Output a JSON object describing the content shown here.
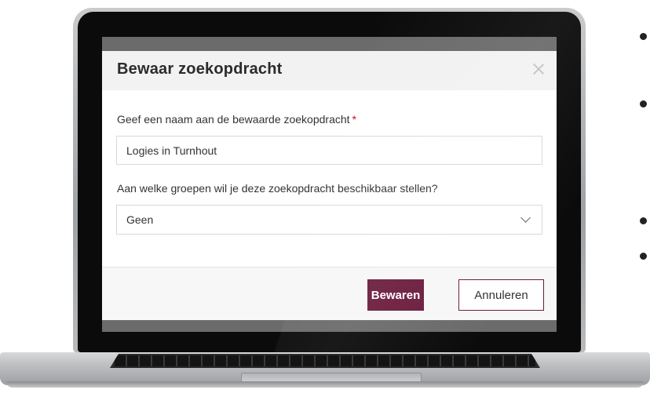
{
  "dialog": {
    "title": "Bewaar zoekopdracht",
    "name_label": "Geef een naam aan de bewaarde zoekopdracht",
    "required_mark": "*",
    "name_value": "Logies in Turnhout",
    "groups_label": "Aan welke groepen wil je deze zoekopdracht beschikbaar stellen?",
    "groups_selected": "Geen",
    "save_label": "Bewaren",
    "cancel_label": "Annuleren",
    "close_icon": "close-icon",
    "dropdown_icon": "chevron-down-icon"
  },
  "colors": {
    "primary": "#6c1d3e",
    "required": "#d0021b",
    "header_bg": "#f2f2f2"
  }
}
